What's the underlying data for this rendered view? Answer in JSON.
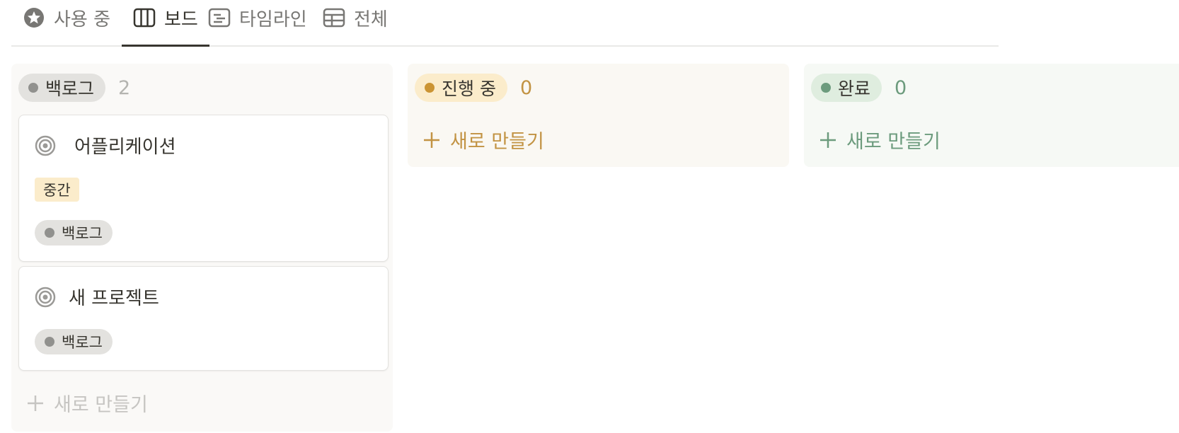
{
  "tabs": [
    {
      "label": "사용 중",
      "icon": "star-circle-icon",
      "active": false
    },
    {
      "label": "보드",
      "icon": "board-columns-icon",
      "active": true
    },
    {
      "label": "타임라인",
      "icon": "timeline-icon",
      "active": false
    },
    {
      "label": "전체",
      "icon": "table-icon",
      "active": false
    }
  ],
  "columns": [
    {
      "status": "백로그",
      "count": "2",
      "colors": {
        "background": "#faf9f7",
        "pill": "#e3e2df",
        "dot": "#91918e",
        "text": "#37352f",
        "count": "#b4b4b0",
        "new": "#c6c5c2"
      },
      "new_label": "새로 만들기",
      "cards": [
        {
          "title": "어플리케이션",
          "icon": "target-icon",
          "priority": "중간",
          "status": "백로그"
        },
        {
          "title": "새 프로젝트",
          "icon": "target-icon",
          "status": "백로그"
        }
      ]
    },
    {
      "status": "진행 중",
      "count": "0",
      "colors": {
        "background": "#faf8f3",
        "pill": "#fbeccb",
        "dot": "#cb9433",
        "text": "#37352f",
        "count": "#c29343",
        "new": "#c29343"
      },
      "new_label": "새로 만들기",
      "cards": []
    },
    {
      "status": "완료",
      "count": "0",
      "colors": {
        "background": "#f6f9f5",
        "pill": "#dfeddf",
        "dot": "#6c9b7d",
        "text": "#37352f",
        "count": "#6c9b7d",
        "new": "#6c9b7d"
      },
      "new_label": "새로 만들기",
      "cards": []
    }
  ]
}
